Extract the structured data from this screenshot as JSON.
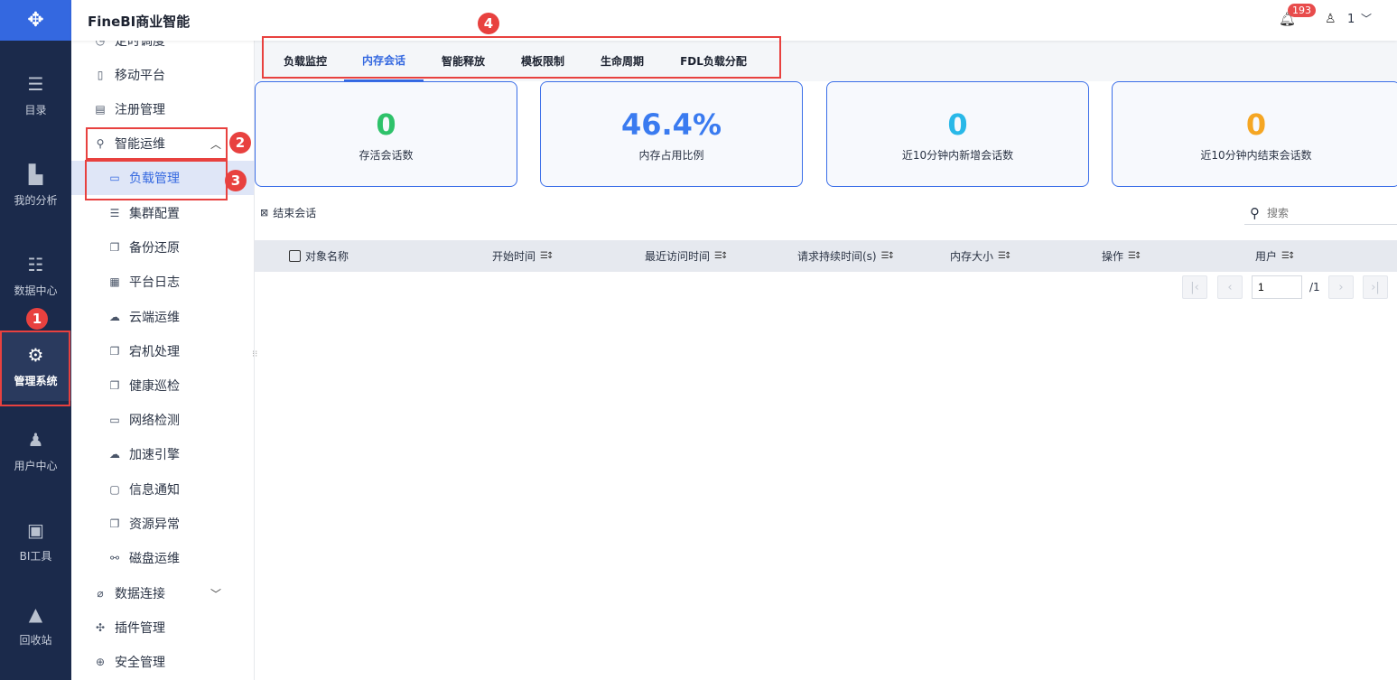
{
  "app": {
    "title": "FineBI商业智能"
  },
  "header": {
    "notification_count": "193",
    "user_name": "1"
  },
  "rail": [
    {
      "label": "目录",
      "icon": "catalog-icon"
    },
    {
      "label": "我的分析",
      "icon": "analysis-icon"
    },
    {
      "label": "数据中心",
      "icon": "data-center-icon"
    },
    {
      "label": "管理系统",
      "icon": "gear-icon",
      "active": true
    },
    {
      "label": "用户中心",
      "icon": "user-icon"
    },
    {
      "label": "BI工具",
      "icon": "toolbox-icon"
    },
    {
      "label": "回收站",
      "icon": "recycle-icon"
    }
  ],
  "sidebar": {
    "items": [
      {
        "label": "定时调度"
      },
      {
        "label": "移动平台"
      },
      {
        "label": "注册管理"
      },
      {
        "label": "智能运维"
      },
      {
        "label": "负载管理"
      },
      {
        "label": "集群配置"
      },
      {
        "label": "备份还原"
      },
      {
        "label": "平台日志"
      },
      {
        "label": "云端运维"
      },
      {
        "label": "宕机处理"
      },
      {
        "label": "健康巡检"
      },
      {
        "label": "网络检测"
      },
      {
        "label": "加速引擎"
      },
      {
        "label": "信息通知"
      },
      {
        "label": "资源异常"
      },
      {
        "label": "磁盘运维"
      },
      {
        "label": "数据连接"
      },
      {
        "label": "插件管理"
      },
      {
        "label": "安全管理"
      }
    ]
  },
  "tabs": [
    {
      "label": "负载监控"
    },
    {
      "label": "内存会话",
      "active": true
    },
    {
      "label": "智能释放"
    },
    {
      "label": "模板限制"
    },
    {
      "label": "生命周期"
    },
    {
      "label": "FDL负载分配"
    }
  ],
  "stats": [
    {
      "value": "0",
      "label": "存活会话数",
      "color": "#2ec26a"
    },
    {
      "value": "46.4%",
      "label": "内存占用比例",
      "color": "#3a7bf0"
    },
    {
      "value": "0",
      "label": "近10分钟内新增会话数",
      "color": "#29b8e8"
    },
    {
      "value": "0",
      "label": "近10分钟内结束会话数",
      "color": "#f5a623"
    }
  ],
  "toolbar": {
    "end_session": "结束会话",
    "search_placeholder": "搜索"
  },
  "table": {
    "columns": [
      "对象名称",
      "开始时间",
      "最近访问时间",
      "请求持续时间(s)",
      "内存大小",
      "操作",
      "用户"
    ]
  },
  "pagination": {
    "page": "1",
    "total": "/1"
  },
  "annotations": [
    "1",
    "2",
    "3",
    "4"
  ]
}
